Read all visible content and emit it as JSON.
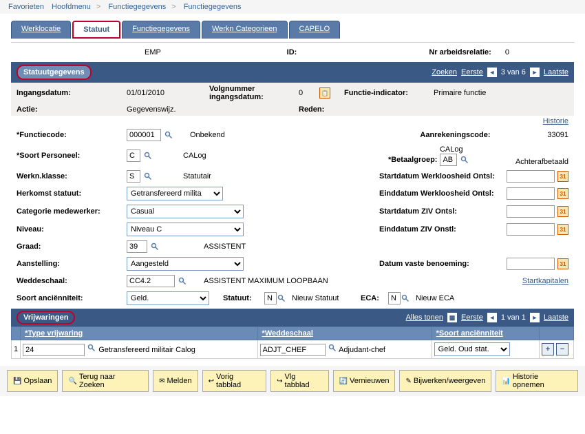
{
  "breadcrumb": {
    "favorieten": "Favorieten",
    "hoofdmenu": "Hoofdmenu",
    "fg1": "Functiegegevens",
    "fg2": "Functiegegevens"
  },
  "tabs": {
    "werklocatie": "Werklocatie",
    "statuut": "Statuut",
    "functiegegevens": "Functiegegevens",
    "werkn_cat": "Werkn Categorieen",
    "capelo": "CAPELO"
  },
  "head": {
    "emp": "EMP",
    "id_lbl": "ID:",
    "nr_rel_lbl": "Nr arbeidsrelatie:",
    "nr_rel_val": "0"
  },
  "section1": {
    "title": "Statuutgegevens",
    "zoeken": "Zoeken",
    "eerste": "Eerste",
    "counter": "3 van 6",
    "laatste": "Laatste",
    "ingangsdatum_lbl": "Ingangsdatum:",
    "ingangsdatum_val": "01/01/2010",
    "volgnr_lbl": "Volgnummer ingangsdatum:",
    "volgnr_val": "0",
    "funcind_lbl": "Functie-indicator:",
    "funcind_val": "Primaire functie",
    "actie_lbl": "Actie:",
    "actie_val": "Gegevenswijz.",
    "reden_lbl": "Reden:",
    "historie": "Historie",
    "functiecode_lbl": "Functiecode:",
    "functiecode_val": "000001",
    "functiecode_desc": "Onbekend",
    "aanrek_lbl": "Aanrekeningscode:",
    "aanrek_val": "33091",
    "soortpers_lbl": "Soort Personeel:",
    "soortpers_val": "C",
    "soortpers_desc": "CALog",
    "calog_txt": "CALog",
    "betaalgr_lbl": "Betaalgroep:",
    "betaalgr_val": "AB",
    "betaalgr_desc": "Achterafbetaald",
    "werknkl_lbl": "Werkn.klasse:",
    "werknkl_val": "S",
    "werknkl_desc": "Statutair",
    "startwerkl_lbl": "Startdatum Werkloosheid Ontsl:",
    "herkomst_lbl": "Herkomst statuut:",
    "herkomst_val": "Getransfereerd milita",
    "eindwerkl_lbl": "Einddatum Werkloosheid Ontsl:",
    "catmed_lbl": "Categorie medewerker:",
    "catmed_val": "Casual",
    "startziv_lbl": "Startdatum ZIV Ontsl:",
    "niveau_lbl": "Niveau:",
    "niveau_val": "Niveau C",
    "eindziv_lbl": "Einddatum ZIV Onstl:",
    "graad_lbl": "Graad:",
    "graad_val": "39",
    "graad_desc": "ASSISTENT",
    "aanst_lbl": "Aanstelling:",
    "aanst_val": "Aangesteld",
    "datvast_lbl": "Datum vaste benoeming:",
    "wedde_lbl": "Weddeschaal:",
    "wedde_val": "CC4.2",
    "wedde_desc": "ASSISTENT MAXIMUM LOOPBAAN",
    "startkap": "Startkapitalen",
    "soortanc_lbl": "Soort anciënniteit:",
    "soortanc_val": "Geld.",
    "statuut_lbl": "Statuut:",
    "statuut_val": "N",
    "statuut_desc": "Nieuw Statuut",
    "eca_lbl": "ECA:",
    "eca_val": "N",
    "eca_desc": "Nieuw ECA"
  },
  "section2": {
    "title": "Vrijwaringen",
    "alles": "Alles tonen",
    "eerste": "Eerste",
    "counter": "1 van 1",
    "laatste": "Laatste",
    "col_type": "Type vrijwaring",
    "col_wedde": "Weddeschaal",
    "col_soort": "Soort anciënniteit",
    "row_num": "1",
    "type_val": "24",
    "type_desc": "Getransfereerd militair Calog",
    "wedde_val": "ADJT_CHEF",
    "wedde_desc": "Adjudant-chef",
    "soort_val": "Geld. Oud stat."
  },
  "footer": {
    "opslaan": "Opslaan",
    "terug": "Terug naar Zoeken",
    "melden": "Melden",
    "vorig": "Vorig tabblad",
    "vlg": "Vlg tabblad",
    "vernieuw": "Vernieuwen",
    "bijw": "Bijwerken/weergeven",
    "hist": "Historie opnemen"
  }
}
